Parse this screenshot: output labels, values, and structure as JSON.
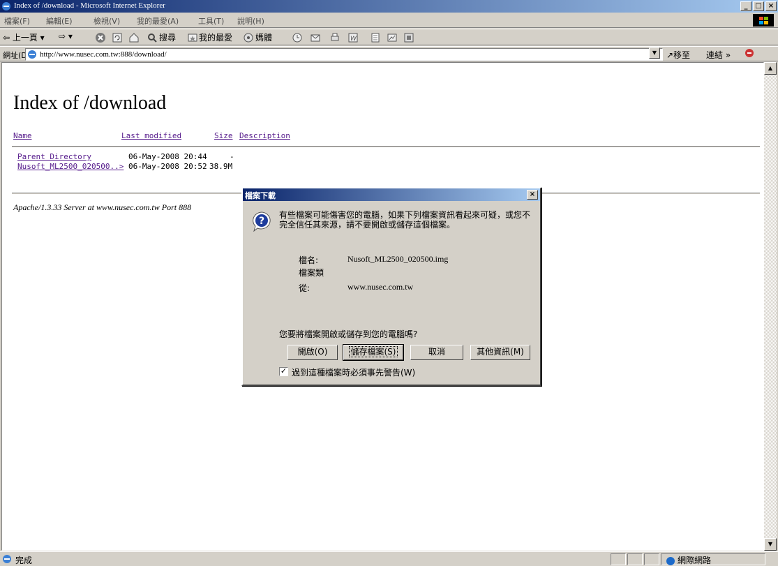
{
  "window": {
    "title": "Index of /download - Microsoft Internet Explorer",
    "min": "_",
    "max": "□",
    "close": "×"
  },
  "menu": {
    "items": [
      "檔案(F)",
      "編輯(E)",
      "檢視(V)",
      "我的最愛(A)",
      "工具(T)",
      "說明(H)"
    ]
  },
  "toolbar": {
    "back": "⇦ 上一頁 ▾",
    "forward": "⇨ ▾",
    "search": "搜尋",
    "favorites": "我的最愛",
    "media": "媽體"
  },
  "address": {
    "label": "網址(D)",
    "url": "http://www.nusec.com.tw:888/download/",
    "dropdown": "▼",
    "go": "↗移至",
    "links": "連結 »"
  },
  "page": {
    "title": "Index of /download",
    "headers": {
      "name": "Name",
      "last_modified": "Last modified",
      "size": "Size",
      "description": "Description"
    },
    "rows": [
      {
        "name": "Parent Directory",
        "modified": "06-May-2008 20:44",
        "size": "-"
      },
      {
        "name": "Nusoft_ML2500_020500..>",
        "modified": "06-May-2008 20:52",
        "size": "38.9M"
      }
    ],
    "footer": "Apache/1.3.33 Server at www.nusec.com.tw Port 888"
  },
  "status": {
    "text": "完成",
    "zone": "網際網路"
  },
  "dialog": {
    "title": "檔案下載",
    "close": "×",
    "message": "有些檔案可能傷害您的電腦，如果下列檔案資訊看起來可疑，或您不完全信任其來源，請不要開啟或儲存這個檔案。",
    "name_label": "檔名:",
    "name_value": "Nusoft_ML2500_020500.img",
    "type_label": "檔案類",
    "from_label": "從:",
    "from_value": "www.nusec.com.tw",
    "question": "您要將檔案開啟或儲存到您的電腦嗎?",
    "open_btn": "開啟(O)",
    "save_btn": "儲存檔案(S)",
    "cancel_btn": "取消",
    "more_btn": "其他資訊(M)",
    "checkbox_checked": "✓",
    "checkbox_label": "過到這種檔案時必須事先警告(W)"
  }
}
